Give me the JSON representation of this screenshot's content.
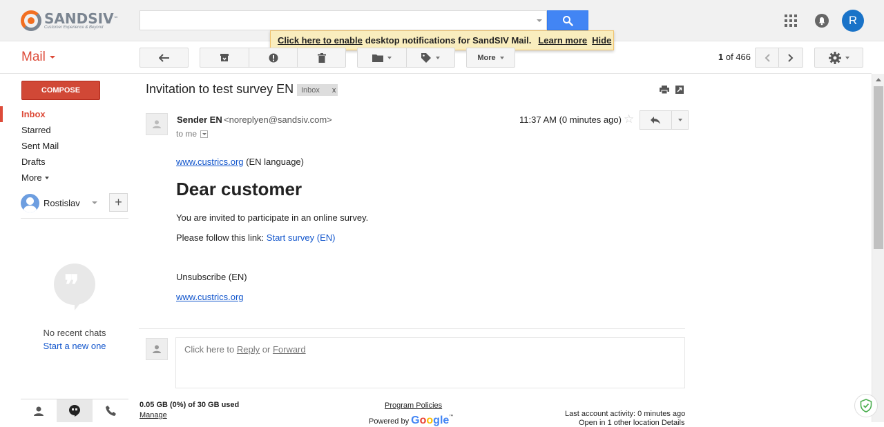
{
  "brand": {
    "name": "SANDSIV",
    "tm": "™",
    "tagline": "Customer Experience & Beyond",
    "color_primary": "#f26f21",
    "color_secondary": "#7b8591"
  },
  "search": {
    "value": "",
    "placeholder": ""
  },
  "account": {
    "initial": "R",
    "color": "#1a73c8"
  },
  "notification": {
    "enable_link": "Click here to enable",
    "message": "desktop notifications for SandSIV Mail.",
    "learn_more": "Learn more",
    "hide": "Hide"
  },
  "app_label": "Mail",
  "toolbar": {
    "more_label": "More",
    "page_current": "1",
    "page_of": "of",
    "page_total": "466"
  },
  "sidebar": {
    "compose_label": "COMPOSE",
    "items": [
      {
        "label": "Inbox",
        "active": true
      },
      {
        "label": "Starred"
      },
      {
        "label": "Sent Mail"
      },
      {
        "label": "Drafts"
      },
      {
        "label": "More"
      }
    ],
    "user_name": "Rostislav",
    "plus": "+",
    "no_chats": "No recent chats",
    "start_new": "Start a new one"
  },
  "message": {
    "subject": "Invitation to test survey EN",
    "label_tag": "Inbox",
    "label_remove": "x",
    "sender_name": "Sender EN",
    "sender_email": "<noreplyen@sandsiv.com>",
    "to": "to me",
    "time": "11:37 AM (0 minutes ago)",
    "star": "☆",
    "body": {
      "top_link": "www.custrics.org",
      "top_suffix": "(EN language)",
      "heading": "Dear customer",
      "para1": "You are invited to participate in an online survey.",
      "para2_prefix": "Please follow this link:",
      "survey_link": "Start survey (EN)",
      "unsubscribe": "Unsubscribe (EN)",
      "bottom_link": "www.custrics.org"
    }
  },
  "reply_box": {
    "prefix": "Click here to",
    "reply": "Reply",
    "or": "or",
    "forward": "Forward"
  },
  "footer": {
    "storage": "0.05 GB (0%) of 30 GB used",
    "manage": "Manage",
    "policies": "Program Policies",
    "powered_by": "Powered by",
    "google_g": "G",
    "google_o1": "o",
    "google_o2": "o",
    "google_gle": "gle",
    "google_tm": "™",
    "last_activity": "Last account activity: 0 minutes ago",
    "details": "Open in 1 other location  Details"
  }
}
